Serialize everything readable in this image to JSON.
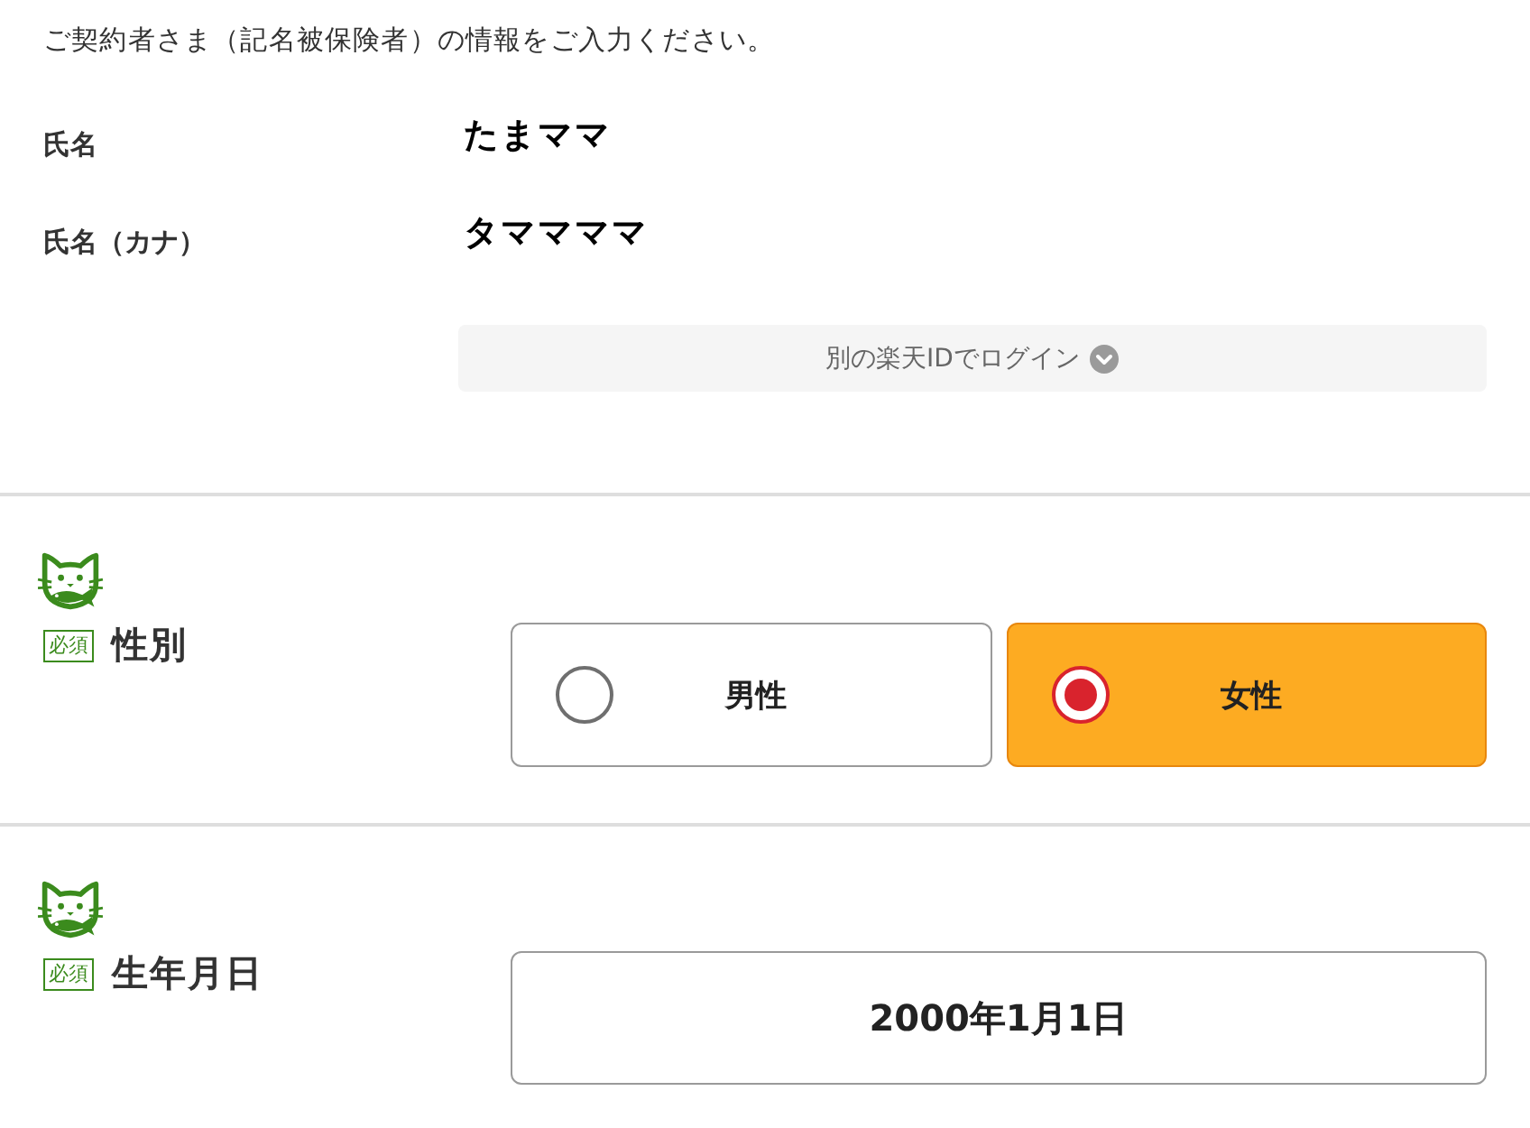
{
  "intro": "ご契約者さま（記名被保険者）の情報をご入力ください。",
  "fields": [
    {
      "label": "氏名",
      "value": "たまママ"
    },
    {
      "label": "氏名（カナ）",
      "value": "タママママ"
    }
  ],
  "login_link": {
    "label": "別の楽天IDでログイン"
  },
  "sections": [
    {
      "kind": "radio",
      "required_badge": "必須",
      "label": "性別",
      "options": [
        {
          "label": "男性",
          "selected": false
        },
        {
          "label": "女性",
          "selected": true
        }
      ]
    },
    {
      "kind": "date",
      "required_badge": "必須",
      "label": "生年月日",
      "value": "2000年1月1日"
    }
  ]
}
